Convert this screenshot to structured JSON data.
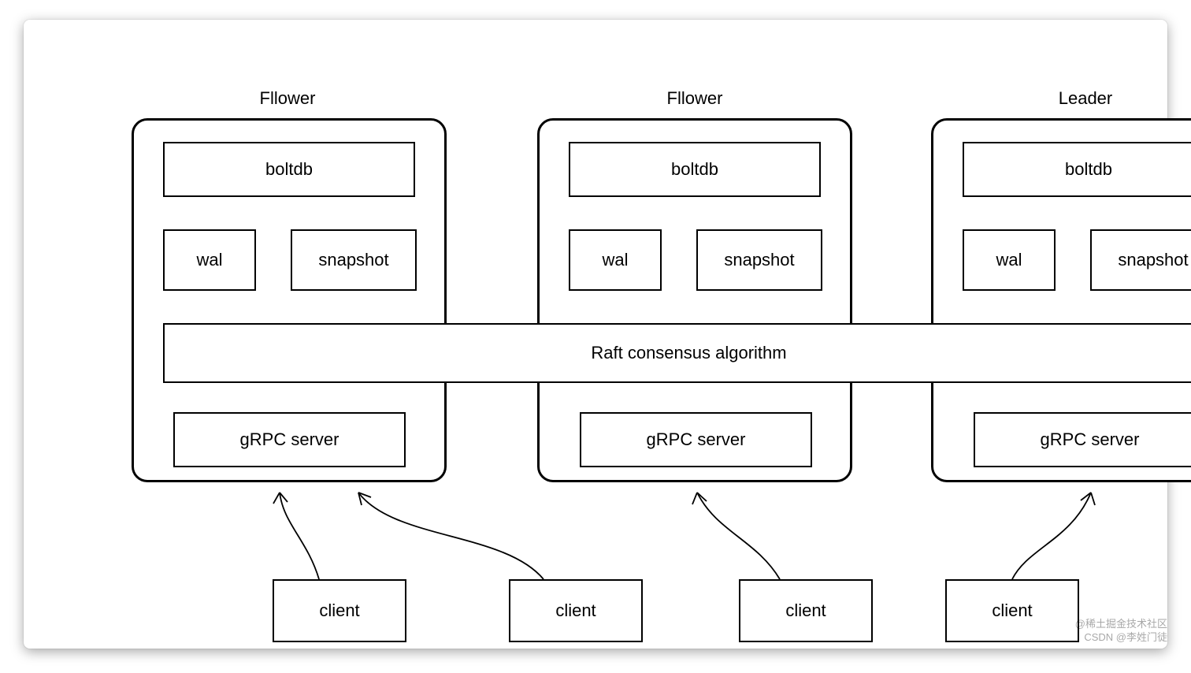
{
  "diagram": {
    "nodes": [
      {
        "title": "Fllower"
      },
      {
        "title": "Fllower"
      },
      {
        "title": "Leader"
      }
    ],
    "components": {
      "boltdb": "boltdb",
      "wal": "wal",
      "snapshot": "snapshot",
      "grpc": "gRPC server"
    },
    "raft_label": "Raft consensus algorithm",
    "clients": [
      "client",
      "client",
      "client",
      "client"
    ]
  },
  "watermark": {
    "line1": "@稀土掘金技术社区",
    "line2": "CSDN @李姓门徒"
  }
}
